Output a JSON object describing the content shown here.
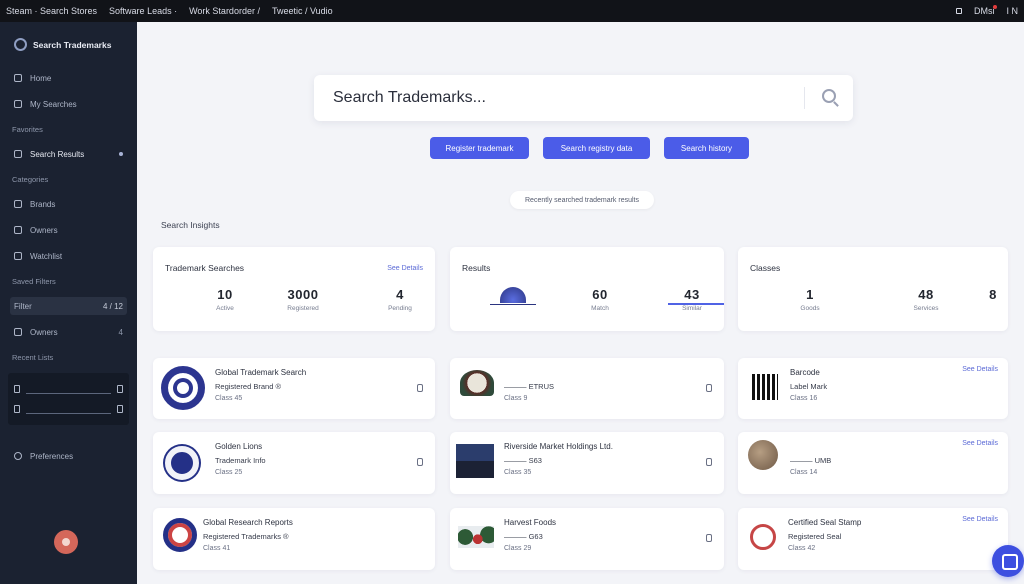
{
  "topbar": {
    "menu": [
      "Steam · Search Stores",
      "Software Leads ·",
      "Work Stardorder /",
      "Tweetic / Vudio"
    ],
    "right_label": "DMsi",
    "right_extra": "I N"
  },
  "sidebar": {
    "brand": "Search Trademarks",
    "items": [
      {
        "label": "Home",
        "section": false
      },
      {
        "label": "My Searches",
        "section": false
      },
      {
        "label": "Favorites",
        "section": true
      },
      {
        "label": "Search Results",
        "section": false,
        "active": true
      },
      {
        "label": "Categories",
        "section": true
      },
      {
        "label": "Brands",
        "section": false
      },
      {
        "label": "Owners",
        "section": false
      },
      {
        "label": "Watchlist",
        "section": false
      },
      {
        "label": "Saved Filters",
        "section": true
      }
    ],
    "filter": {
      "label": "Filter",
      "count": "4 / 12"
    },
    "owners_item": {
      "label": "Owners",
      "count": "4"
    },
    "slots_title": "Recent Lists",
    "settings_label": "Preferences"
  },
  "search": {
    "placeholder": "Search Trademarks..."
  },
  "chips": [
    "Register trademark",
    "Search registry data",
    "Search history"
  ],
  "pill": "Recently searched trademark results",
  "section_title": "Search Insights",
  "stats": [
    {
      "title": "Trademark Searches",
      "link": "See Details",
      "values": [
        {
          "val": "10",
          "lbl": "Active"
        },
        {
          "val": "3000",
          "lbl": "Registered"
        },
        {
          "val": "4",
          "lbl": "Pending"
        }
      ]
    },
    {
      "title": "Results",
      "values": [
        {
          "val": "60",
          "lbl": "Match"
        },
        {
          "val": "43",
          "lbl": "Similar"
        }
      ],
      "progress": 1
    },
    {
      "title": "Classes",
      "values": [
        {
          "val": "1",
          "lbl": "Goods"
        },
        {
          "val": "48",
          "lbl": "Services"
        },
        {
          "val": "8",
          "lbl": ""
        }
      ]
    }
  ],
  "items": [
    {
      "t1": "Global Trademark Search",
      "t2": "Registered Brand ®",
      "t3": "Class 45",
      "link": ""
    },
    {
      "t1": "",
      "t2": "——— ETRUS",
      "t3": "Class 9",
      "link": ""
    },
    {
      "t1": "Barcode",
      "t2": "Label Mark",
      "t3": "Class 16",
      "link": "See Details"
    },
    {
      "t1": "Golden Lions",
      "t2": "Trademark Info",
      "t3": "Class 25",
      "link": ""
    },
    {
      "t1": "Riverside Market Holdings Ltd.",
      "t2": "——— S63",
      "t3": "Class 35",
      "link": ""
    },
    {
      "t1": "",
      "t2": "——— UMB",
      "t3": "Class 14",
      "link": "See Details"
    },
    {
      "t1": "Global Research Reports",
      "t2": "Registered Trademarks ®",
      "t3": "Class 41",
      "link": ""
    },
    {
      "t1": "Harvest Foods",
      "t2": "——— G63",
      "t3": "Class 29",
      "link": ""
    },
    {
      "t1": "Certified Seal Stamp",
      "t2": "Registered Seal",
      "t3": "Class 42",
      "link": "See Details"
    }
  ],
  "colors": {
    "accent": "#4b5ce8",
    "sidebar": "#1b2231",
    "topbar": "#111318"
  }
}
